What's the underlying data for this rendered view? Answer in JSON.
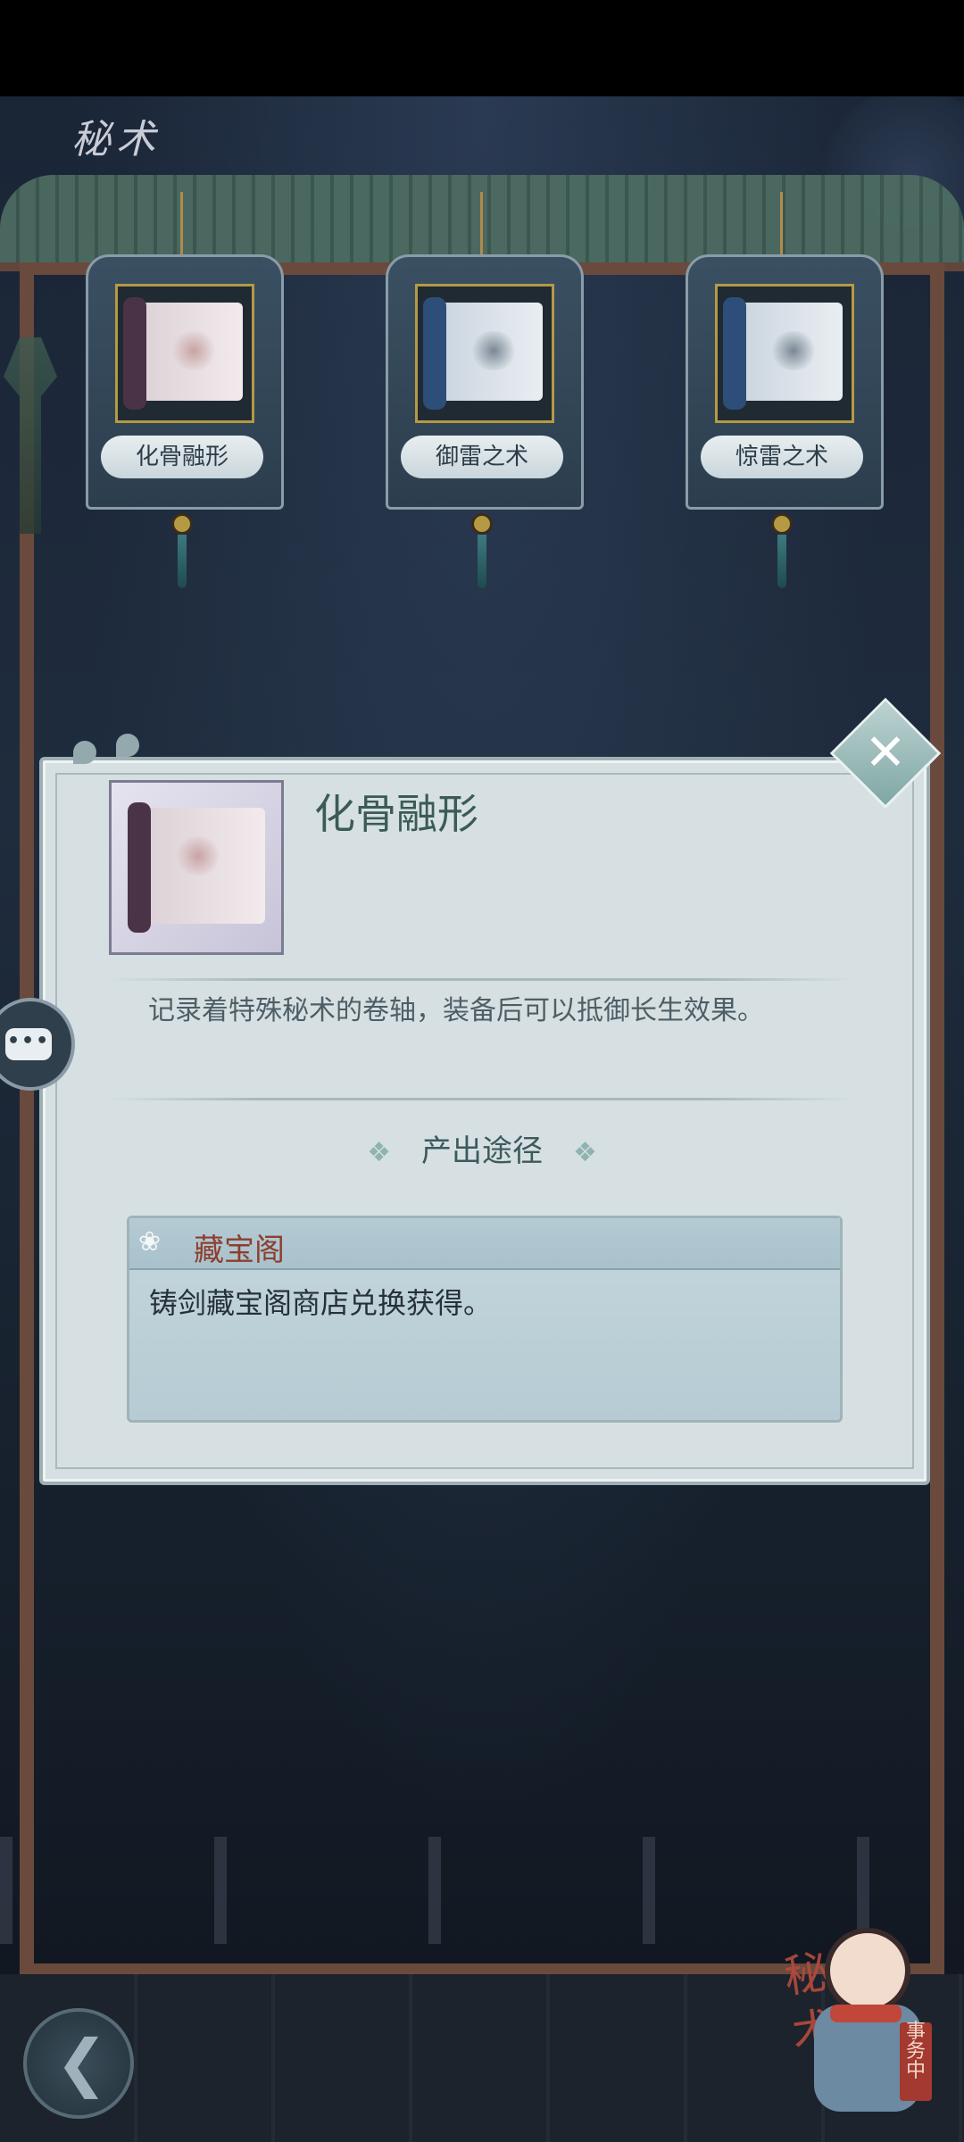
{
  "header": {
    "title_art": "秘术"
  },
  "scroll_cards": [
    {
      "label": "化骨融形"
    },
    {
      "label": "御雷之术"
    },
    {
      "label": "惊雷之术"
    }
  ],
  "dialog": {
    "item_name": "化骨融形",
    "description": "记录着特殊秘术的卷轴，装备后可以抵御长生效果。",
    "source_heading": "产出途径",
    "source_title": "藏宝阁",
    "source_text": "铸剑藏宝阁商店兑换获得。"
  },
  "corner_badge": {
    "text": "秘术",
    "seal": "事务中"
  },
  "icons": {
    "close": "close-icon",
    "back": "back-icon",
    "chat": "chat-icon",
    "lotus": "lotus-icon",
    "diamond": "diamond-ornament-icon"
  },
  "colors": {
    "dialog_bg": "#d6e0e2",
    "item_name": "#3b5a58",
    "source_title": "#8c3f2f",
    "accent_teal": "#7fa7a4"
  }
}
